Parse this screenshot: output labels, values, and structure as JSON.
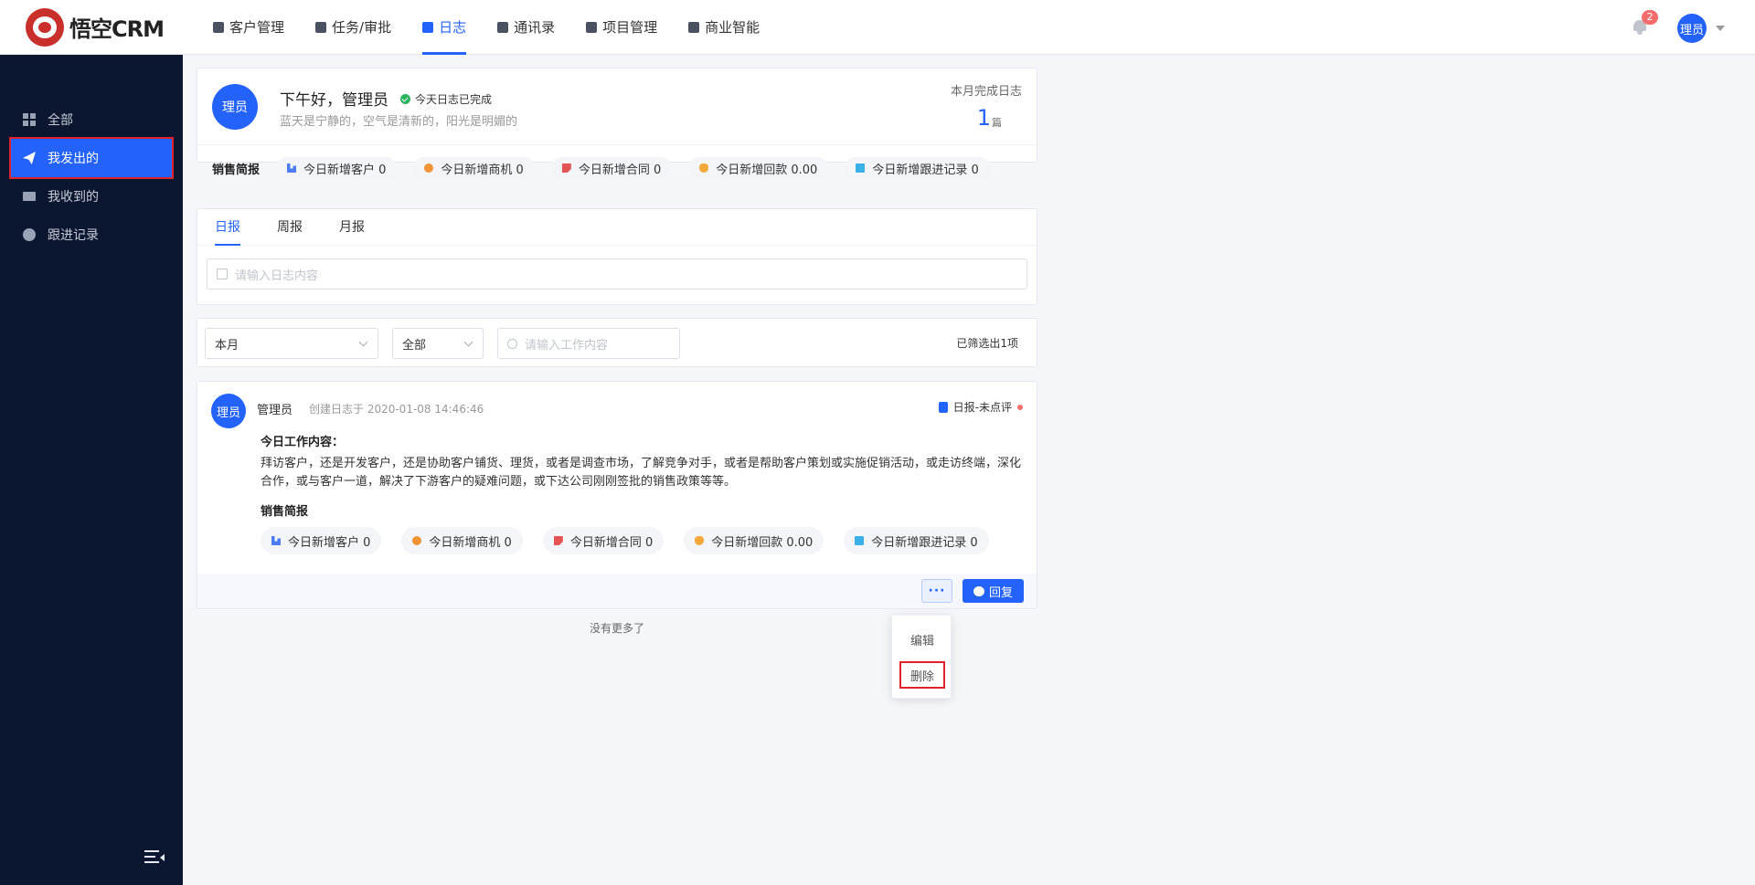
{
  "app": {
    "logo_text": "悟空CRM"
  },
  "nav": [
    {
      "label": "客户管理",
      "icon": "customer-icon",
      "active": false
    },
    {
      "label": "任务/审批",
      "icon": "briefcase-icon",
      "active": false
    },
    {
      "label": "日志",
      "icon": "log-icon",
      "active": true
    },
    {
      "label": "通讯录",
      "icon": "contacts-icon",
      "active": false
    },
    {
      "label": "项目管理",
      "icon": "project-icon",
      "active": false
    },
    {
      "label": "商业智能",
      "icon": "bi-icon",
      "active": false
    }
  ],
  "header": {
    "notification_count": "2",
    "user_avatar": "理员"
  },
  "sidebar": {
    "items": [
      {
        "label": "全部",
        "icon": "grid-icon"
      },
      {
        "label": "我发出的",
        "icon": "paper-plane-icon"
      },
      {
        "label": "我收到的",
        "icon": "mail-icon"
      },
      {
        "label": "跟进记录",
        "icon": "chat-icon"
      }
    ]
  },
  "greeting": {
    "avatar": "理员",
    "title": "下午好，管理员",
    "done_status": "今天日志已完成",
    "subtitle": "蓝天是宁静的，空气是清新的，阳光是明媚的",
    "month_label": "本月完成日志",
    "month_count": "1",
    "month_unit": "篇"
  },
  "sales_brief": {
    "title": "销售简报",
    "items": [
      {
        "label": "今日新增客户 0",
        "icon": "customer-chart-icon"
      },
      {
        "label": "今日新增商机 0",
        "icon": "opportunity-icon"
      },
      {
        "label": "今日新增合同 0",
        "icon": "contract-icon"
      },
      {
        "label": "今日新增回款 0.00",
        "icon": "money-bag-icon"
      },
      {
        "label": "今日新增跟进记录 0",
        "icon": "follow-record-icon"
      }
    ]
  },
  "tabs": [
    {
      "label": "日报",
      "active": true
    },
    {
      "label": "周报",
      "active": false
    },
    {
      "label": "月报",
      "active": false
    }
  ],
  "compose": {
    "placeholder": "请输入日志内容"
  },
  "filters": {
    "time_value": "本月",
    "scope_value": "全部",
    "search_placeholder": "请输入工作内容",
    "result_text": "已筛选出1项"
  },
  "log": {
    "avatar": "理员",
    "author": "管理员",
    "created": "创建日志于 2020-01-08 14:46:46",
    "type": "日报-未点评",
    "content_title": "今日工作内容：",
    "content": "拜访客户，还是开发客户，还是协助客户铺货、理货，或者是调查市场，了解竞争对手，或者是帮助客户策划或实施促销活动，或走访终端，深化合作，或与客户一道，解决了下游客户的疑难问题，或下达公司刚刚签批的销售政策等等。",
    "brief_title": "销售简报",
    "more_label": "···",
    "reply_label": "回复"
  },
  "no_more": "没有更多了",
  "dropdown": {
    "edit": "编辑",
    "delete": "删除"
  },
  "colors": {
    "primary": "#2362fb",
    "sidebar_bg": "#0b1630",
    "highlight": "#e0222a"
  }
}
